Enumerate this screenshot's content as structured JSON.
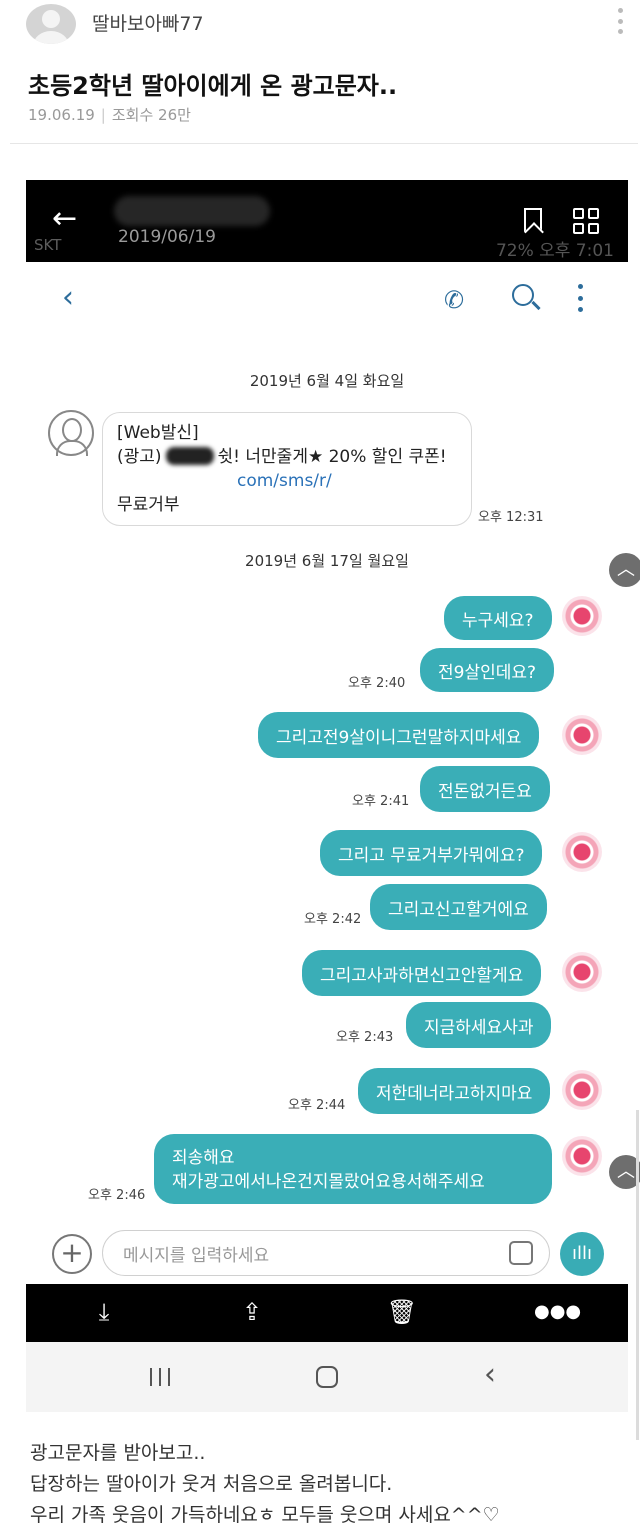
{
  "post": {
    "author": "딸바보아빠77",
    "title": "초등2학년 딸아이에게 온 광고문자..",
    "date": "19.06.19",
    "views_label": "조회수",
    "views_value": "26만",
    "caption": [
      "광고문자를 받아보고..",
      "답장하는 딸아이가 웃겨 처음으로 올려봅니다.",
      "우리 가족 웃음이 가득하네요ㅎ 모두들 웃으며 사세요^^♡"
    ]
  },
  "viewer": {
    "date": "2019/06/19",
    "carrier": "SKT",
    "status": "72% 오후 7:01"
  },
  "chat": {
    "date_sep_1": "2019년 6월 4일 화요일",
    "date_sep_2": "2019년 6월 17일 월요일",
    "incoming": {
      "line1": "[Web발신]",
      "line2_prefix": "(광고)",
      "line2_text": "쉿! 너만줄게★ 20% 할인 쿠폰!",
      "url": "com/sms/r/",
      "optout": "무료거부",
      "time": "오후 12:31"
    },
    "messages": [
      {
        "text": "누구세요?"
      },
      {
        "text": "전9살인데요?",
        "time": "오후 2:40"
      },
      {
        "text": "그리고전9살이니그런말하지마세요"
      },
      {
        "text": "전돈없거든요",
        "time": "오후 2:41"
      },
      {
        "text": "그리고 무료거부가뭐에요?"
      },
      {
        "text": "그리고신고할거에요",
        "time": "오후 2:42"
      },
      {
        "text": "그리고사과하면신고안할게요"
      },
      {
        "text": "지금하세요사과",
        "time": "오후 2:43"
      },
      {
        "text": "저한데너라고하지마요",
        "time": "오후 2:44"
      },
      {
        "line1": "죄송해요",
        "line2": "재가광고에서나온건지몰랐어요용서해주세요",
        "time": "오후 2:46"
      }
    ],
    "input_placeholder": "메시지를 입력하세요"
  },
  "icons": {
    "back": "arrow-left",
    "bookmark": "bookmark",
    "grid": "grid",
    "call": "hd-call",
    "search": "search",
    "more": "more-vertical",
    "download": "download",
    "share": "share",
    "delete": "trash",
    "mic": "voice"
  },
  "colors": {
    "bubble_out": "#3aaeb7",
    "accent_blue": "#2d6d9b"
  }
}
